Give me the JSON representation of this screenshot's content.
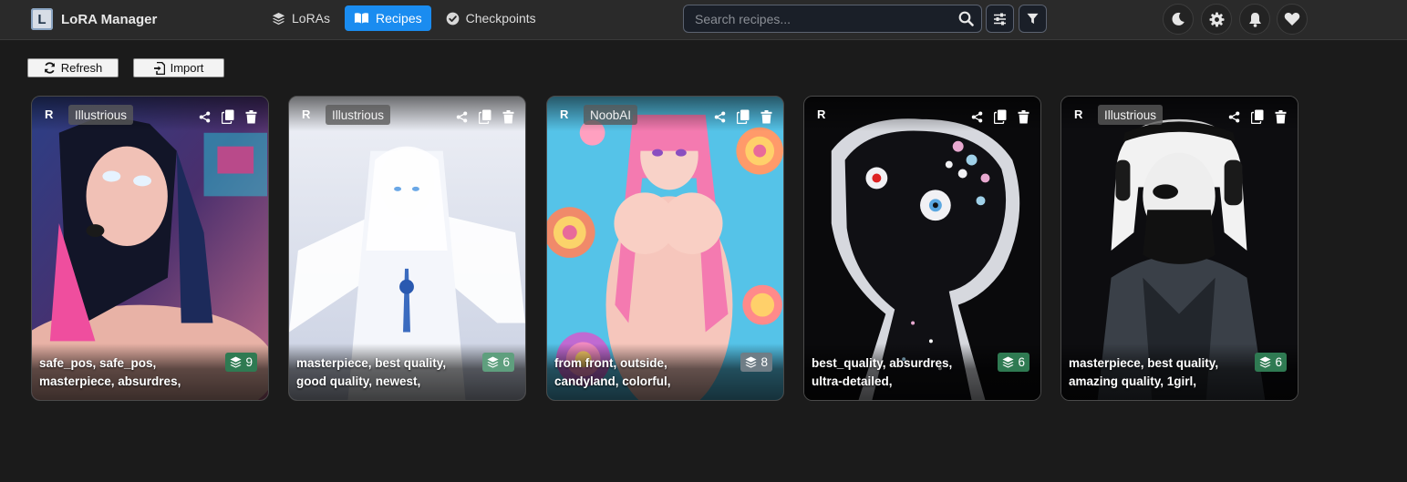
{
  "app": {
    "title": "LoRA Manager",
    "logo_letter": "L"
  },
  "nav": {
    "loras": "LoRAs",
    "recipes": "Recipes",
    "checkpoints": "Checkpoints",
    "active": "recipes"
  },
  "search": {
    "placeholder": "Search recipes...",
    "value": ""
  },
  "toolbar": {
    "refresh": "Refresh",
    "import": "Import"
  },
  "colors": {
    "accent": "#1a8cf0",
    "badge_green": "#2f7a52",
    "background": "#1b1b1b",
    "header": "#2a2a2a"
  },
  "header_icons": [
    "search-icon",
    "filter-settings-icon",
    "filter-icon",
    "moon-icon",
    "gear-icon",
    "bell-icon",
    "heart-icon"
  ],
  "cards": [
    {
      "r": "R",
      "base_model": "Illustrious",
      "prompt_line1": "safe_pos, safe_pos,",
      "prompt_line2": "masterpiece, absurdres,",
      "lora_count": "9"
    },
    {
      "r": "R",
      "base_model": "Illustrious",
      "prompt_line1": "masterpiece, best quality,",
      "prompt_line2": "good quality, newest,",
      "lora_count": "6"
    },
    {
      "r": "R",
      "base_model": "NoobAI",
      "prompt_line1": "from front, outside,",
      "prompt_line2": "candyland, colorful,",
      "lora_count": "8"
    },
    {
      "r": "R",
      "base_model": "",
      "prompt_line1": "best_quality, absurdres,",
      "prompt_line2": "ultra-detailed,",
      "lora_count": "6"
    },
    {
      "r": "R",
      "base_model": "Illustrious",
      "prompt_line1": "masterpiece, best quality,",
      "prompt_line2": "amazing quality, 1girl,",
      "lora_count": "6"
    }
  ]
}
